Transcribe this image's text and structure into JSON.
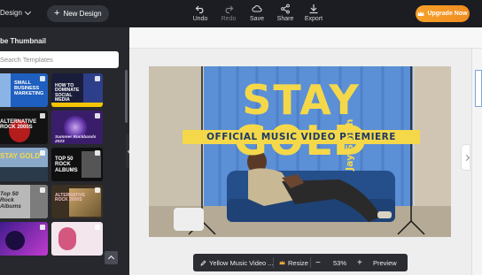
{
  "topbar": {
    "design_menu": "Design",
    "new_design": "New Design",
    "tools": [
      {
        "label": "Undo",
        "icon": "undo-icon",
        "enabled": true
      },
      {
        "label": "Redo",
        "icon": "redo-icon",
        "enabled": false
      },
      {
        "label": "Save",
        "icon": "cloud-save-icon",
        "enabled": true
      },
      {
        "label": "Share",
        "icon": "share-icon",
        "enabled": true
      },
      {
        "label": "Export",
        "icon": "download-icon",
        "enabled": true
      }
    ],
    "upgrade": "Upgrade Now"
  },
  "sidebar": {
    "title": "be Thumbnail",
    "search_placeholder": "Search Templates",
    "thumbnails": [
      {
        "caption": "SMALL BUSINESS MARKETING"
      },
      {
        "caption": "HOW TO DOMINATE SOCIAL MEDIA"
      },
      {
        "caption": "ALTERNATIVE ROCK 2000S"
      },
      {
        "caption": "Summer Rockbands 2023"
      },
      {
        "caption": "STAY GOLD"
      },
      {
        "caption": "TOP 50 ROCK ALBUMS"
      },
      {
        "caption": "Top 50 Rock Albums"
      },
      {
        "caption": "ALTERNATIVE ROCK 2000S"
      },
      {
        "caption": ""
      },
      {
        "caption": ""
      }
    ]
  },
  "canvas": {
    "headline": "STAY GOLD",
    "subheadline": "OFFICIAL MUSIC VIDEO PREMIERE",
    "artist": "Jay Smith"
  },
  "bottombar": {
    "design_name": "Yellow Music Video ...",
    "resize": "Resize",
    "zoom": "53%",
    "zoom_out": "−",
    "zoom_in": "+",
    "preview": "Preview"
  },
  "colors": {
    "topbar": "#1b1d22",
    "sidebar": "#26282d",
    "workspace": "#eeeeef",
    "upgrade": "#f39a25",
    "headline": "#f4d84a",
    "curtain": "#5b8fd6"
  }
}
